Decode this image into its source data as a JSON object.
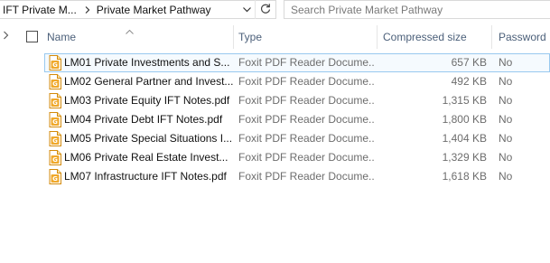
{
  "address_bar": {
    "breadcrumbs": [
      "IFT Private M...",
      "Private Market Pathway"
    ]
  },
  "search": {
    "placeholder": "Search Private Market Pathway"
  },
  "columns": {
    "name": "Name",
    "type": "Type",
    "compressed_size": "Compressed size",
    "password": "Password ..."
  },
  "files": [
    {
      "name": "LM01 Private Investments and S...",
      "type": "Foxit PDF Reader Docume...",
      "size": "657 KB",
      "password": "No",
      "selected": true
    },
    {
      "name": "LM02 General Partner and Invest...",
      "type": "Foxit PDF Reader Docume...",
      "size": "492 KB",
      "password": "No"
    },
    {
      "name": "LM03 Private Equity IFT Notes.pdf",
      "type": "Foxit PDF Reader Docume...",
      "size": "1,315 KB",
      "password": "No"
    },
    {
      "name": "LM04 Private Debt IFT Notes.pdf",
      "type": "Foxit PDF Reader Docume...",
      "size": "1,800 KB",
      "password": "No"
    },
    {
      "name": "LM05 Private Special Situations I...",
      "type": "Foxit PDF Reader Docume...",
      "size": "1,404 KB",
      "password": "No"
    },
    {
      "name": "LM06 Private Real Estate Invest...",
      "type": "Foxit PDF Reader Docume...",
      "size": "1,329 KB",
      "password": "No"
    },
    {
      "name": "LM07 Infrastructure IFT Notes.pdf",
      "type": "Foxit PDF Reader Docume...",
      "size": "1,618 KB",
      "password": "No"
    }
  ],
  "icons": {
    "breadcrumb_separator": "chevron-right-icon",
    "address_dropdown": "chevron-down-icon",
    "refresh": "refresh-icon",
    "sort": "sort-ascending-icon",
    "file": "foxit-pdf-icon"
  },
  "colors": {
    "header_text": "#4c607a",
    "selection_border": "#99c9ef",
    "pdf_icon_orange": "#e8a317"
  }
}
